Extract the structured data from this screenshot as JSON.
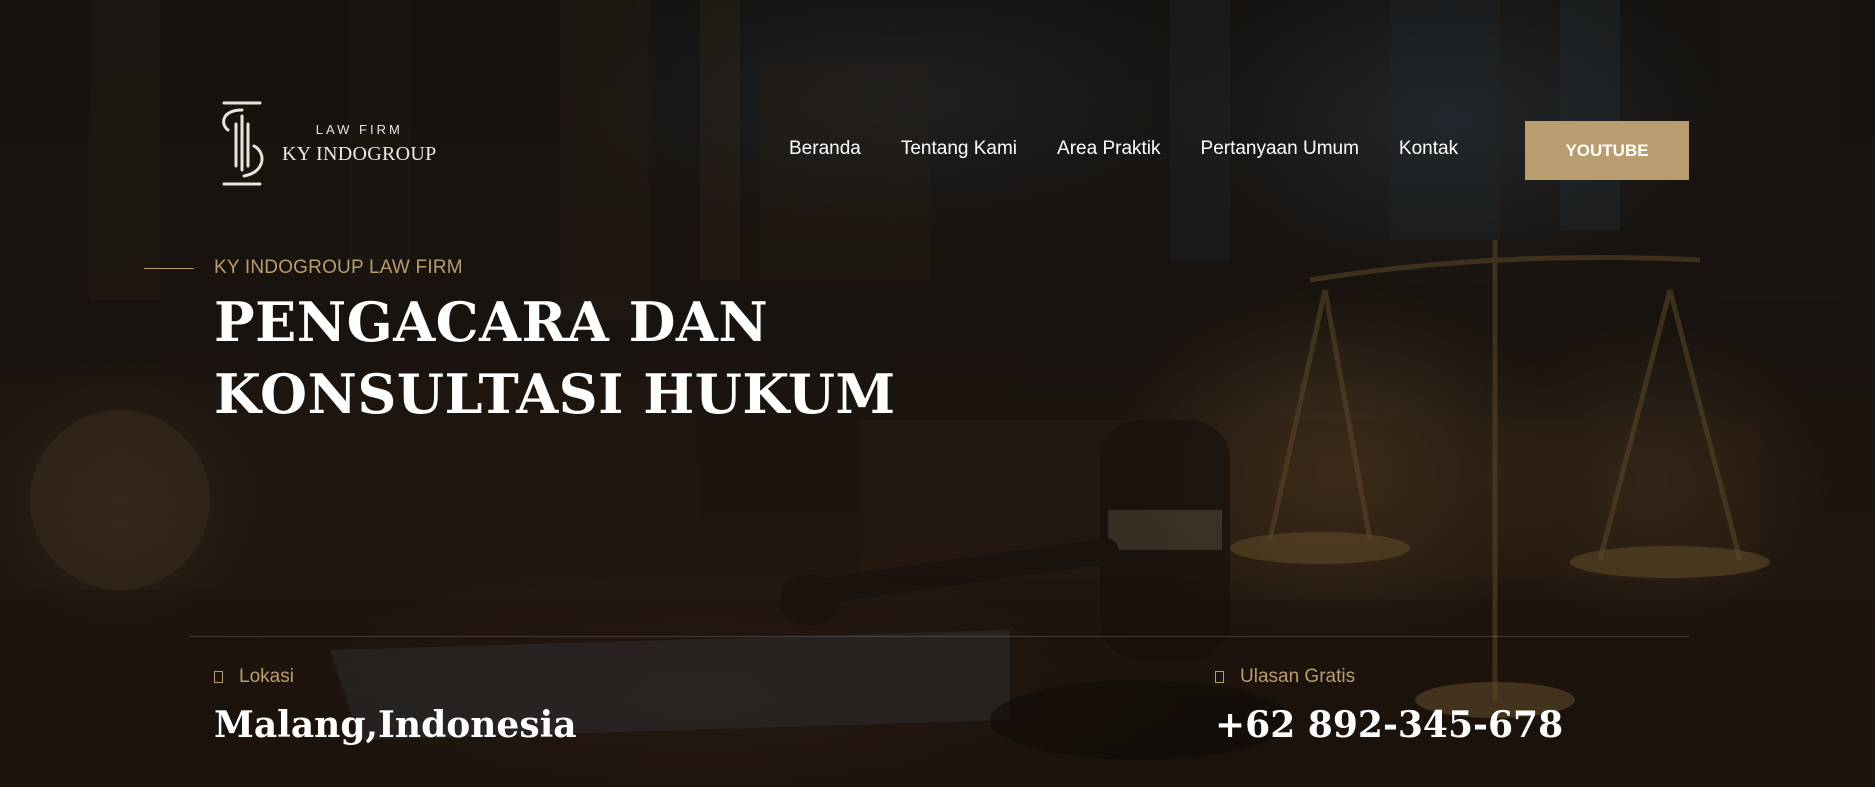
{
  "brand": {
    "subtitle": "LAW FIRM",
    "name": "KY INDOGROUP"
  },
  "nav": {
    "items": [
      {
        "label": "Beranda"
      },
      {
        "label": "Tentang Kami"
      },
      {
        "label": "Area Praktik"
      },
      {
        "label": "Pertanyaan Umum"
      },
      {
        "label": "Kontak"
      }
    ],
    "cta_label": "YOUTUBE"
  },
  "hero": {
    "eyebrow": "KY INDOGROUP LAW FIRM",
    "headline_line1": "PENGACARA DAN",
    "headline_line2": "KONSULTASI HUKUM"
  },
  "info": {
    "location": {
      "label": "Lokasi",
      "value": "Malang,Indonesia",
      "icon": "location-icon"
    },
    "review": {
      "label": "Ulasan Gratis",
      "value": "+62 892-345-678",
      "icon": "phone-icon"
    }
  },
  "colors": {
    "accent": "#b99d6f",
    "text": "#ffffff",
    "background": "#1c1612"
  }
}
